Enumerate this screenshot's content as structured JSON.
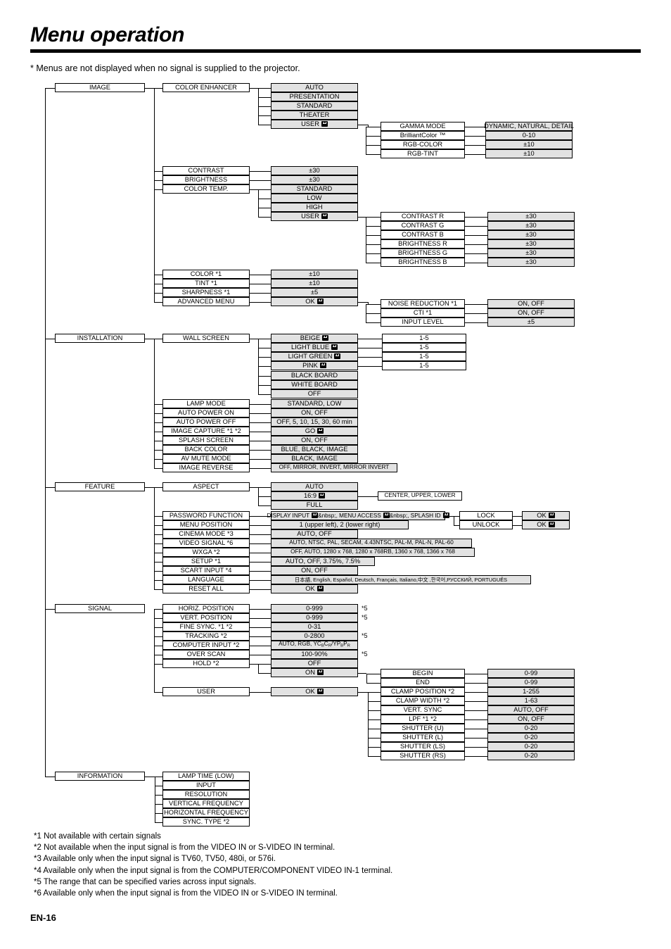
{
  "header": {
    "title": "Menu operation",
    "note": "* Menus are not displayed when no signal is supplied to the projector."
  },
  "page_number": "EN-16",
  "enter_icon": "enter-key-icon",
  "menu_tree": {
    "image": {
      "label": "IMAGE",
      "color_enhancer": {
        "label": "COLOR ENHANCER",
        "options": [
          "AUTO",
          "PRESENTATION",
          "STANDARD",
          "THEATER",
          "USER"
        ],
        "user_sub": [
          {
            "label": "GAMMA MODE",
            "value": "DYNAMIC, NATURAL, DETAIL"
          },
          {
            "label": "BrilliantColor ™",
            "value": "0-10"
          },
          {
            "label": "RGB-COLOR",
            "value": "±10"
          },
          {
            "label": "RGB-TINT",
            "value": "±10"
          }
        ]
      },
      "items": [
        {
          "label": "CONTRAST",
          "value": "±30"
        },
        {
          "label": "BRIGHTNESS",
          "value": "±30"
        },
        {
          "label": "COLOR TEMP.",
          "value": ""
        }
      ],
      "color_temp_options": [
        "STANDARD",
        "LOW",
        "HIGH",
        "USER"
      ],
      "color_temp_user_sub": [
        {
          "label": "CONTRAST R",
          "value": "±30"
        },
        {
          "label": "CONTRAST G",
          "value": "±30"
        },
        {
          "label": "CONTRAST B",
          "value": "±30"
        },
        {
          "label": "BRIGHTNESS R",
          "value": "±30"
        },
        {
          "label": "BRIGHTNESS G",
          "value": "±30"
        },
        {
          "label": "BRIGHTNESS B",
          "value": "±30"
        }
      ],
      "items2": [
        {
          "label": "COLOR *1",
          "value": "±10"
        },
        {
          "label": "TINT *1",
          "value": "±10"
        },
        {
          "label": "SHARPNESS *1",
          "value": "±5"
        },
        {
          "label": "ADVANCED MENU",
          "value": "OK"
        }
      ],
      "advanced_sub": [
        {
          "label": "NOISE REDUCTION *1",
          "value": "ON, OFF"
        },
        {
          "label": "CTI *1",
          "value": "ON, OFF"
        },
        {
          "label": "INPUT LEVEL",
          "value": "±5"
        }
      ]
    },
    "installation": {
      "label": "INSTALLATION",
      "wall_screen": {
        "label": "WALL SCREEN",
        "options": [
          "BEIGE",
          "LIGHT BLUE",
          "LIGHT GREEN",
          "PINK",
          "BLACK BOARD",
          "WHITE BOARD",
          "OFF"
        ],
        "option_ranges": [
          "1-5",
          "1-5",
          "1-5",
          "1-5"
        ]
      },
      "items": [
        {
          "label": "LAMP MODE",
          "value": "STANDARD, LOW"
        },
        {
          "label": "AUTO POWER ON",
          "value": "ON, OFF"
        },
        {
          "label": "AUTO POWER OFF",
          "value": "OFF, 5, 10, 15, 30, 60 min"
        },
        {
          "label": "IMAGE CAPTURE *1 *2",
          "value": "GO"
        },
        {
          "label": "SPLASH SCREEN",
          "value": "ON, OFF"
        },
        {
          "label": "BACK COLOR",
          "value": "BLUE, BLACK, IMAGE"
        },
        {
          "label": "AV MUTE MODE",
          "value": "BLACK, IMAGE"
        },
        {
          "label": "IMAGE REVERSE",
          "value": "OFF, MIRROR, INVERT, MIRROR INVERT"
        }
      ]
    },
    "feature": {
      "label": "FEATURE",
      "aspect": {
        "label": "ASPECT",
        "options": [
          "AUTO",
          "16:9",
          "FULL"
        ],
        "sub_16_9": "CENTER, UPPER, LOWER"
      },
      "items": [
        {
          "label": "PASSWORD FUNCTION",
          "value": "DISPLAY INPUT , MENU ACCESS , SPLASH ID "
        },
        {
          "label": "MENU POSITION",
          "value": "1 (upper left),  2 (lower right)"
        },
        {
          "label": "CINEMA MODE *3",
          "value": "AUTO, OFF"
        },
        {
          "label": "VIDEO SIGNAL *6",
          "value": "AUTO, NTSC, PAL, SECAM, 4.43NTSC, PAL-M, PAL-N, PAL-60"
        },
        {
          "label": "WXGA *2",
          "value": "OFF, AUTO, 1280 x 768, 1280 x 768RB, 1360 x 768, 1366 x 768"
        },
        {
          "label": "SETUP *1",
          "value": "AUTO, OFF, 3.75%, 7.5%"
        },
        {
          "label": "SCART INPUT *4",
          "value": "ON, OFF"
        },
        {
          "label": "LANGUAGE",
          "value": "日本語, English, Español, Deutsch, Français, Italiano,中文 ,한국어,РУССКИЙ, PORTUGUÊS"
        },
        {
          "label": "RESET ALL",
          "value": "OK"
        }
      ],
      "password_sub": [
        {
          "label": "LOCK",
          "value": "OK"
        },
        {
          "label": "UNLOCK",
          "value": "OK"
        }
      ]
    },
    "signal": {
      "label": "SIGNAL",
      "items": [
        {
          "label": "HORIZ. POSITION",
          "value": "0-999",
          "note": "*5"
        },
        {
          "label": "VERT. POSITION",
          "value": "0-999",
          "note": "*5"
        },
        {
          "label": "FINE SYNC. *1 *2",
          "value": "0-31",
          "note": ""
        },
        {
          "label": "TRACKING *2",
          "value": "0-2800",
          "note": "*5"
        },
        {
          "label": "COMPUTER INPUT *2",
          "value": "AUTO, RGB, YCBCR/YPBPR",
          "note": ""
        },
        {
          "label": "OVER SCAN",
          "value": "100-90%",
          "note": "*5"
        },
        {
          "label": "HOLD *2",
          "value": "OFF",
          "note": ""
        }
      ],
      "hold_on": "ON",
      "user": {
        "label": "USER",
        "value": "OK"
      },
      "user_sub": [
        {
          "label": "BEGIN",
          "value": "0-99"
        },
        {
          "label": "END",
          "value": "0-99"
        },
        {
          "label": "CLAMP POSITION *2",
          "value": "1-255"
        },
        {
          "label": "CLAMP WIDTH *2",
          "value": "1-63"
        },
        {
          "label": "VERT. SYNC",
          "value": "AUTO, OFF"
        },
        {
          "label": "LPF *1 *2",
          "value": "ON, OFF"
        },
        {
          "label": "SHUTTER (U)",
          "value": "0-20"
        },
        {
          "label": "SHUTTER (L)",
          "value": "0-20"
        },
        {
          "label": "SHUTTER (LS)",
          "value": "0-20"
        },
        {
          "label": "SHUTTER (RS)",
          "value": "0-20"
        }
      ]
    },
    "information": {
      "label": "INFORMATION",
      "items": [
        "LAMP TIME (LOW)",
        "INPUT",
        "RESOLUTION",
        "VERTICAL FREQUENCY",
        "HORIZONTAL FREQUENCY",
        "SYNC. TYPE *2"
      ]
    }
  },
  "footnotes": [
    "*1 Not available with certain signals",
    "*2 Not available when the input signal is from the VIDEO IN or S-VIDEO IN terminal.",
    "*3 Available only when the input signal is TV60, TV50, 480i, or 576i.",
    "*4 Available only when the input signal is from the COMPUTER/COMPONENT VIDEO IN-1 terminal.",
    "*5 The range that can be specified varies across input signals.",
    "*6 Available only when the input signal is from the VIDEO IN or S-VIDEO IN terminal."
  ]
}
